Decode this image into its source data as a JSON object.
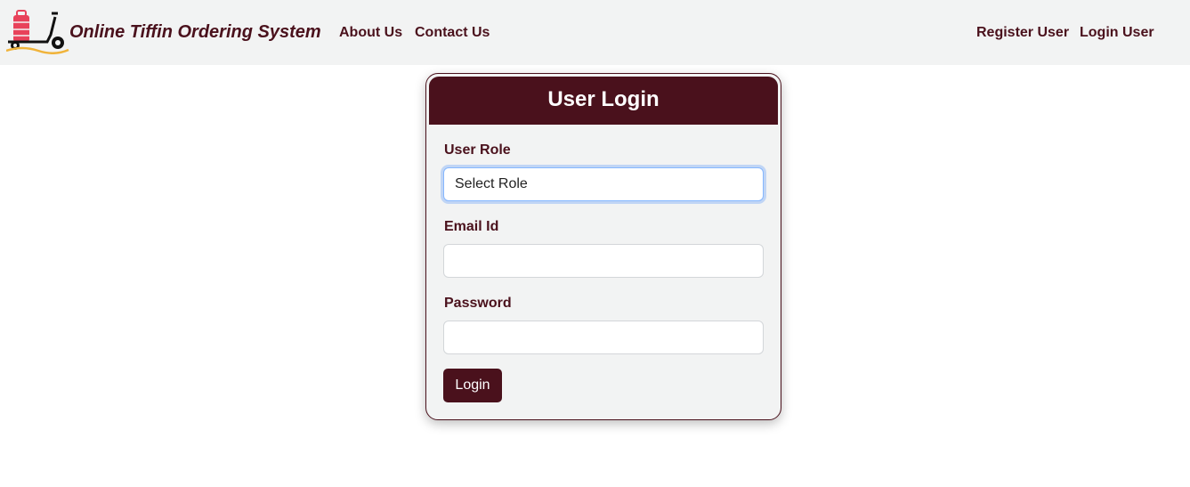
{
  "navbar": {
    "brand_title": "Online Tiffin Ordering System",
    "links_left": [
      "About Us",
      "Contact Us"
    ],
    "links_right": [
      "Register User",
      "Login User"
    ]
  },
  "login_card": {
    "title": "User Login",
    "role_label": "User Role",
    "role_value": "Select Role",
    "email_label": "Email Id",
    "email_value": "",
    "password_label": "Password",
    "password_value": "",
    "login_button": "Login"
  },
  "colors": {
    "brand": "#4a111c",
    "navbar_bg": "#f2f3f3",
    "logo_bag": "#e8425a",
    "logo_wave": "#f0b33a"
  }
}
